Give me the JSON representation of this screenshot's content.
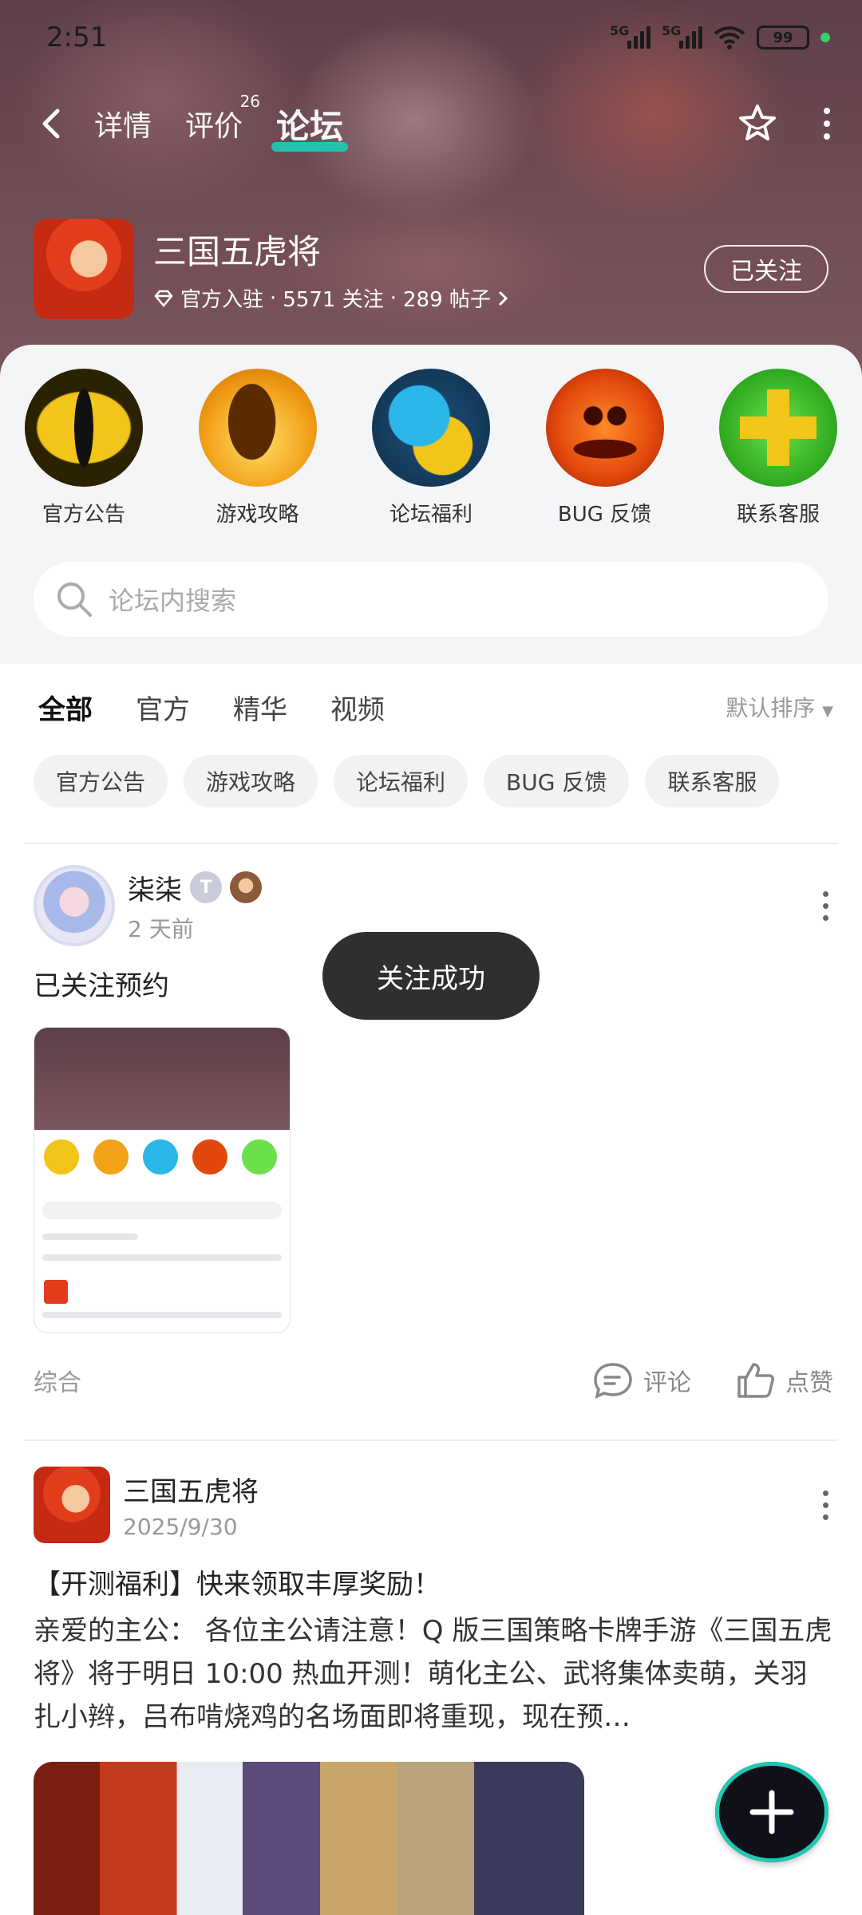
{
  "status": {
    "time": "2:51",
    "net1": "5G",
    "net2": "5G",
    "battery": "99"
  },
  "nav": {
    "tabs": [
      {
        "label": "详情"
      },
      {
        "label": "评价",
        "badge": "26"
      },
      {
        "label": "论坛"
      }
    ],
    "active_tab": "论坛"
  },
  "game": {
    "name": "三国五虎将",
    "meta_official": "官方入驻",
    "meta_follow": "5571 关注",
    "meta_posts": "289 帖子",
    "follow_button": "已关注"
  },
  "categories": [
    {
      "label": "官方公告",
      "icon": "eye-icon"
    },
    {
      "label": "游戏攻略",
      "icon": "guide-icon"
    },
    {
      "label": "论坛福利",
      "icon": "gift-icon"
    },
    {
      "label": "BUG 反馈",
      "icon": "pumpkin-icon"
    },
    {
      "label": "联系客服",
      "icon": "plus-cross-icon"
    }
  ],
  "search": {
    "placeholder": "论坛内搜索"
  },
  "filter_tabs": [
    "全部",
    "官方",
    "精华",
    "视频"
  ],
  "filter_active": "全部",
  "sort_label": "默认排序",
  "chips": [
    "官方公告",
    "游戏攻略",
    "论坛福利",
    "BUG 反馈",
    "联系客服"
  ],
  "posts": [
    {
      "author": "柒柒",
      "time": "2 天前",
      "text": "已关注预约",
      "category": "综合",
      "comment_label": "评论",
      "like_label": "点赞"
    },
    {
      "author": "三国五虎将",
      "time": "2025/9/30",
      "title": "【开测福利】快来领取丰厚奖励！",
      "body": "亲爱的主公： 各位主公请注意！Q 版三国策略卡牌手游《三国五虎将》将于明日 10:00 热血开测！萌化主公、武将集体卖萌，关羽扎小辫，吕布啃烧鸡的名场面即将重现，现在预…"
    }
  ],
  "toast": "关注成功",
  "colors": {
    "accent": "#1fc9b4",
    "hero_bg": "#6d4a52"
  }
}
